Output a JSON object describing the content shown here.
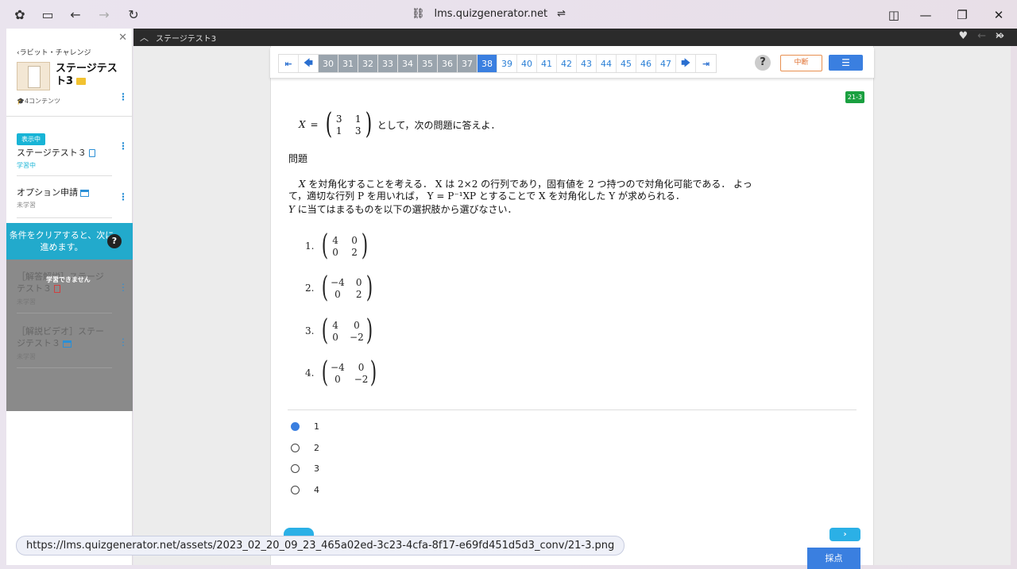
{
  "browser": {
    "url": "lms.quizgenerator.net",
    "status_url": "https://lms.quizgenerator.net/assets/2023_02_20_09_23_465a02ed-3c23-4cfa-8f17-e69fd451d5d3_conv/21-3.png"
  },
  "sidebar": {
    "back_label": "‹ラビット・チャレンジ",
    "course_title": "ステージテスト3",
    "contents_count": "🎓4コンテンツ",
    "current_badge": "表示中",
    "items": [
      {
        "title": "ステージテスト３",
        "status": "学習中"
      },
      {
        "title": "オプション申請",
        "status": "未学習"
      }
    ],
    "lock_banner": "条件をクリアすると、次に進めます。",
    "lock_overlay": "学習できません",
    "locked_items": [
      {
        "title": "［解答解説］ステージテスト３",
        "status": "未学習"
      },
      {
        "title": "［解説ビデオ］ステージテスト３",
        "status": "未学習"
      }
    ]
  },
  "content_header": {
    "title": "ステージテスト3"
  },
  "toolbar": {
    "pages_done": [
      "30",
      "31",
      "32",
      "33",
      "34",
      "35",
      "36",
      "37"
    ],
    "page_current": "38",
    "pages_after": [
      "39",
      "40",
      "41",
      "42",
      "43",
      "44",
      "45",
      "46",
      "47"
    ],
    "help": "?",
    "pause_label": "中断",
    "menu_icon": "☰"
  },
  "question": {
    "id_badge": "21-3",
    "intro_suffix": "として，次の問題に答えよ．",
    "heading": "問題",
    "body_line1": "を対角化することを考える． X は 2×2 の行列であり，固有値を 2 つ持つので対角化可能である． よっ",
    "body_line2": "て，適切な行列 P を用いれば， Y = P⁻¹XP とすることで X を対角化した Y が求められる．",
    "body_line3": "に当てはまるものを以下の選択肢から選びなさい．",
    "options": [
      {
        "num": "1.",
        "m": [
          "4",
          "0",
          "0",
          "2"
        ]
      },
      {
        "num": "2.",
        "m": [
          "−4",
          "0",
          "0",
          "2"
        ]
      },
      {
        "num": "3.",
        "m": [
          "4",
          "0",
          "0",
          "−2"
        ]
      },
      {
        "num": "4.",
        "m": [
          "−4",
          "0",
          "0",
          "−2"
        ]
      }
    ],
    "x_matrix": [
      "3",
      "1",
      "1",
      "3"
    ]
  },
  "answers": {
    "choices": [
      "1",
      "2",
      "3",
      "4"
    ],
    "selected": "1"
  },
  "buttons": {
    "next": "›",
    "grade": "採点"
  }
}
